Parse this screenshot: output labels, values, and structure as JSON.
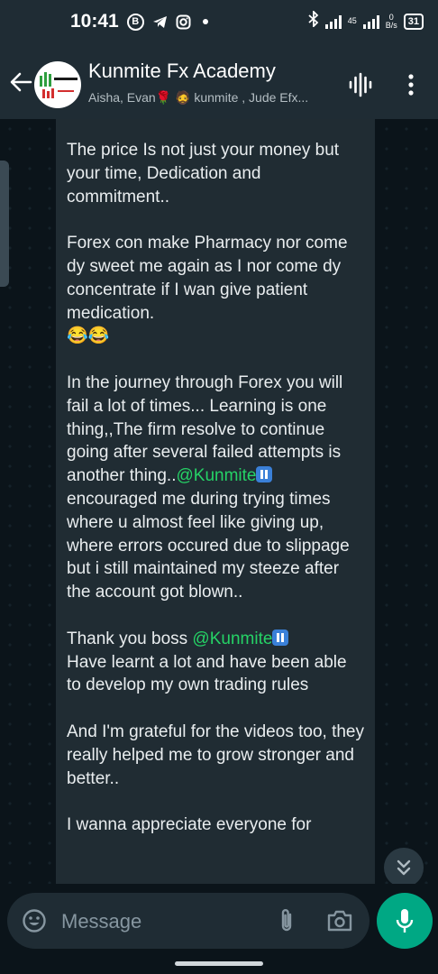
{
  "status_bar": {
    "time": "10:41",
    "network_top": "45",
    "network_bottom": "0",
    "network_unit": "B/s",
    "battery": "31"
  },
  "header": {
    "title": "Kunmite Fx Academy",
    "subtitle": "Aisha, Evan🌹 🧔 kunmite , Jude Efx..."
  },
  "message": {
    "p1": "The price Is not just your money but your time, Dedication and commitment..",
    "p2": "Forex con make Pharmacy nor come dy sweet me again as I nor come dy concentrate if I wan give patient medication.",
    "p2_emoji": "😂😂",
    "p3_a": "In the journey through Forex you will fail a lot of times... Learning is one thing,,The firm resolve to continue going after several failed attempts is another thing..",
    "p3_mention": "@Kunmite",
    "p3_b": " encouraged me during trying times where u almost feel like giving up, where errors occured due to slippage but i still maintained my steeze after the account got blown..",
    "p4_a": "Thank you boss ",
    "p4_mention": "@Kunmite",
    "p4_b": "Have learnt a lot and have been able to develop my own trading rules",
    "p5": "And I'm grateful for the videos too, they really helped me to grow stronger and better..",
    "p6": "I wanna appreciate everyone for"
  },
  "composer": {
    "placeholder": "Message"
  },
  "colors": {
    "accent_green": "#00a884",
    "mention": "#25d366",
    "bubble": "#202c33",
    "bar": "#1f2c34"
  },
  "icons": [
    "back-arrow-icon",
    "group-avatar",
    "voice-chat-icon",
    "more-options-icon",
    "emoji-icon",
    "attach-icon",
    "camera-icon",
    "mic-icon",
    "scroll-down-icon"
  ]
}
